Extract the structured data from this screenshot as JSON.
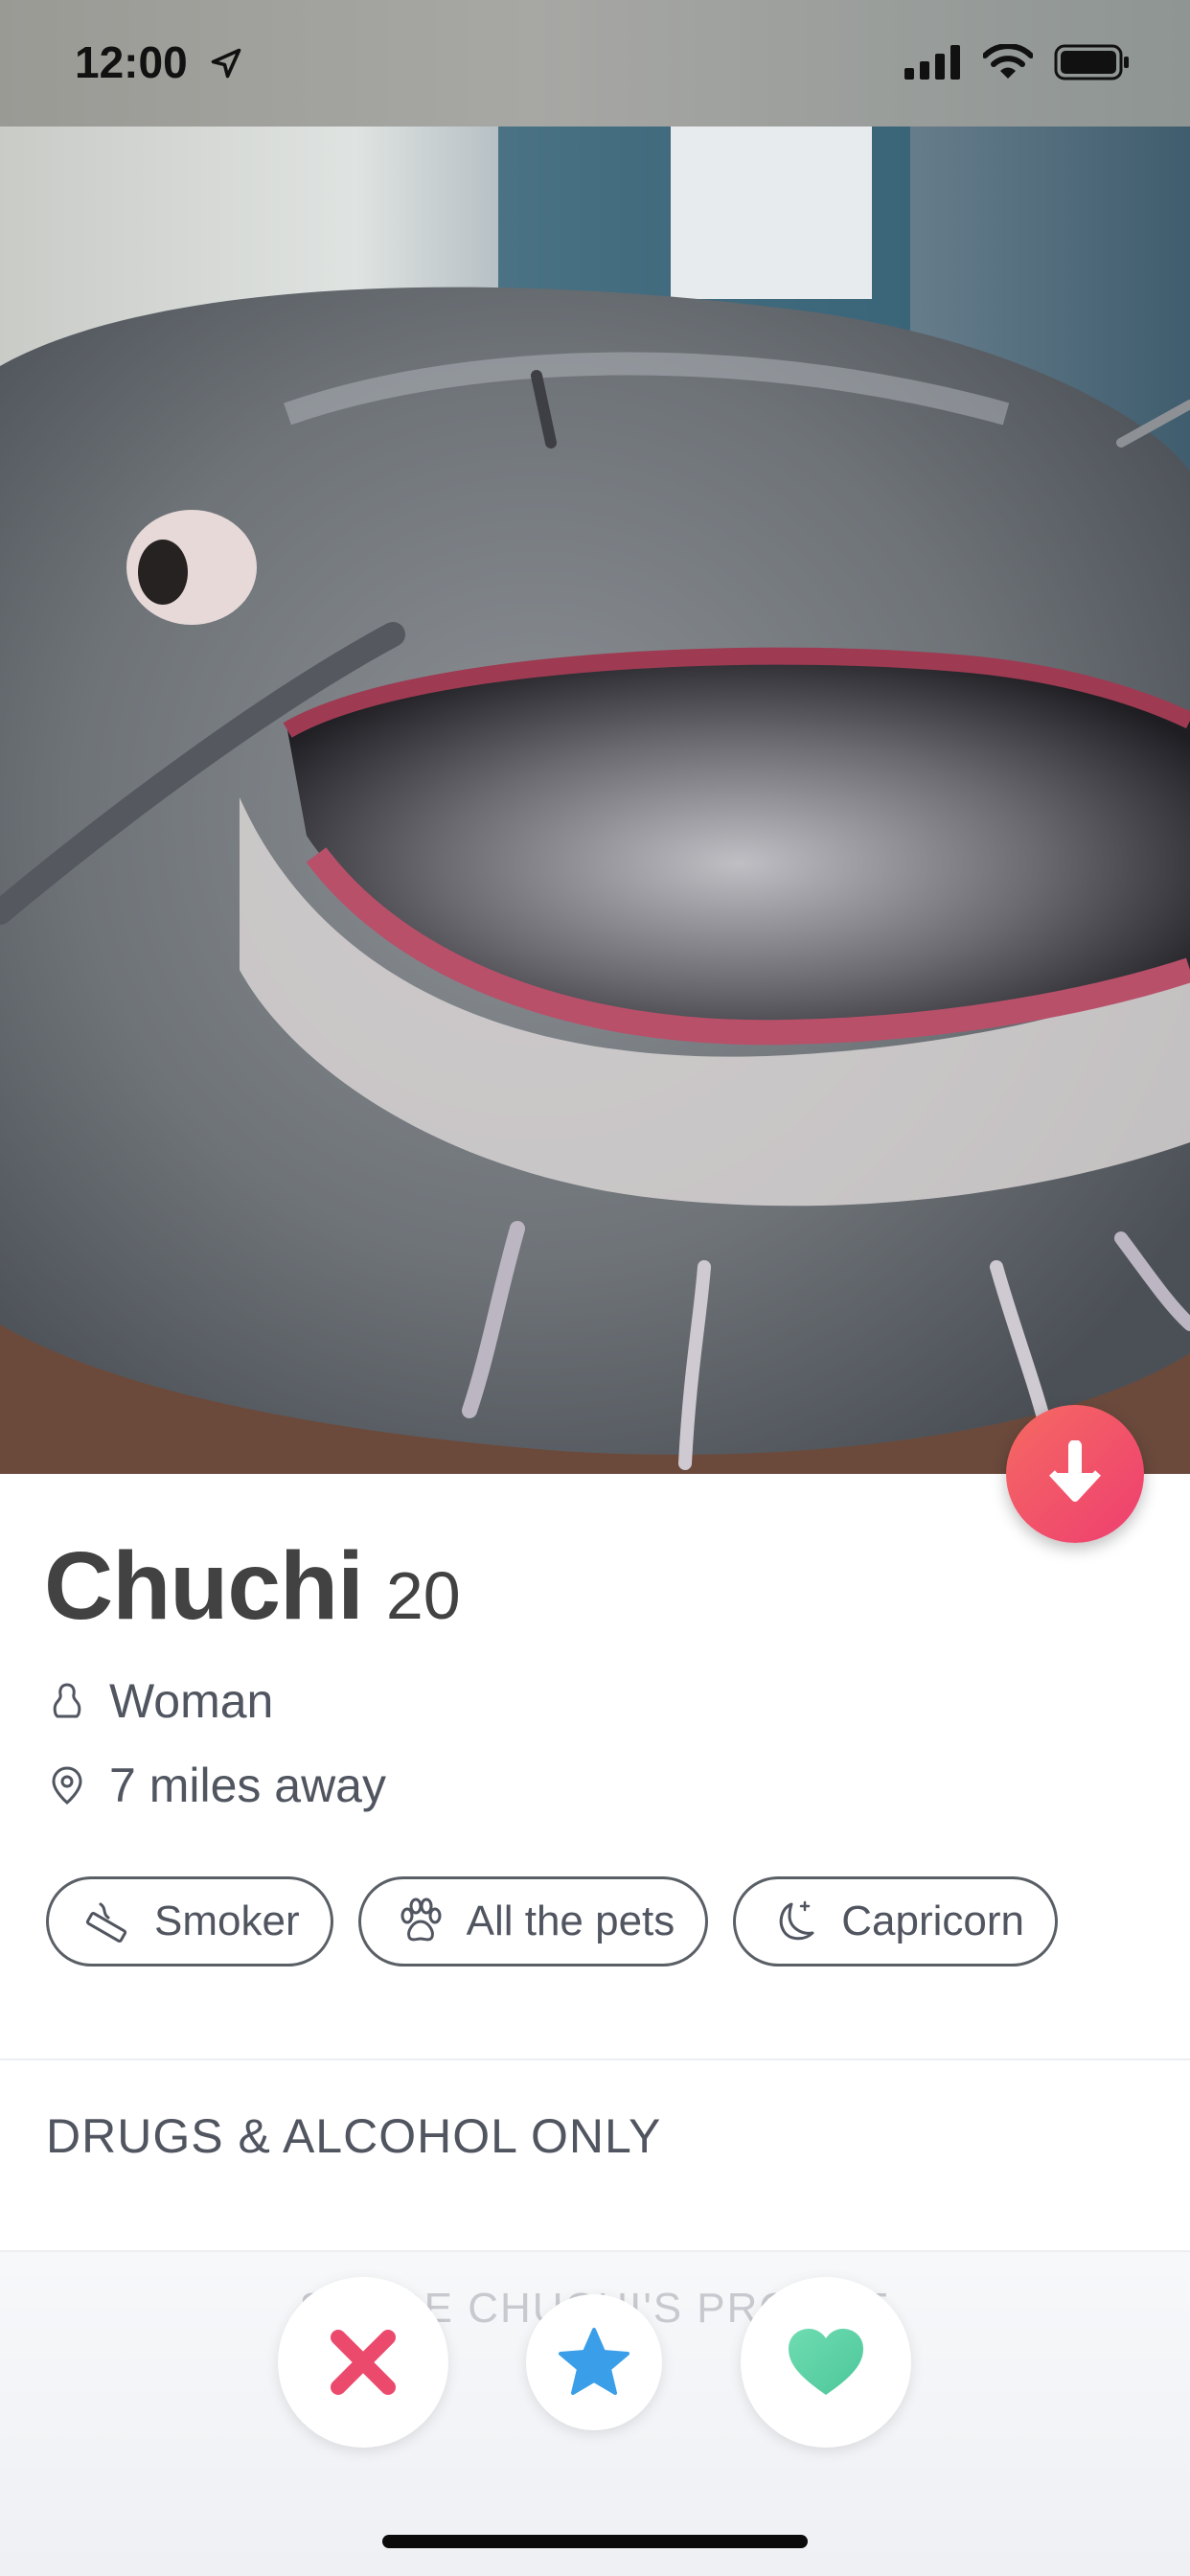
{
  "status_bar": {
    "time": "12:00",
    "icons": [
      "location-arrow-icon",
      "cellular-signal-icon",
      "wifi-icon",
      "battery-icon"
    ]
  },
  "photo": {
    "content": "catfish profile photo"
  },
  "profile": {
    "name": "Chuchi",
    "age": "20",
    "gender": "Woman",
    "distance": "7 miles away",
    "passions": [
      {
        "label": "Smoker",
        "icon": "cigarette-icon"
      },
      {
        "label": "All the pets",
        "icon": "paw-icon"
      },
      {
        "label": "Capricorn",
        "icon": "moon-icon"
      }
    ],
    "about": "DRUGS & ALCOHOL ONLY"
  },
  "actions": {
    "faded_link": "SHARE CHUCHI'S PROFILE",
    "nope_icon": "x-icon",
    "superlike_icon": "star-icon",
    "like_icon": "heart-icon"
  },
  "colors": {
    "fab_gradient_start": "#f56a62",
    "fab_gradient_end": "#ee3e70",
    "nope": "#ec4a6d",
    "superlike": "#3a9ee8",
    "like": "#5fd4a8",
    "text": "#424242"
  }
}
